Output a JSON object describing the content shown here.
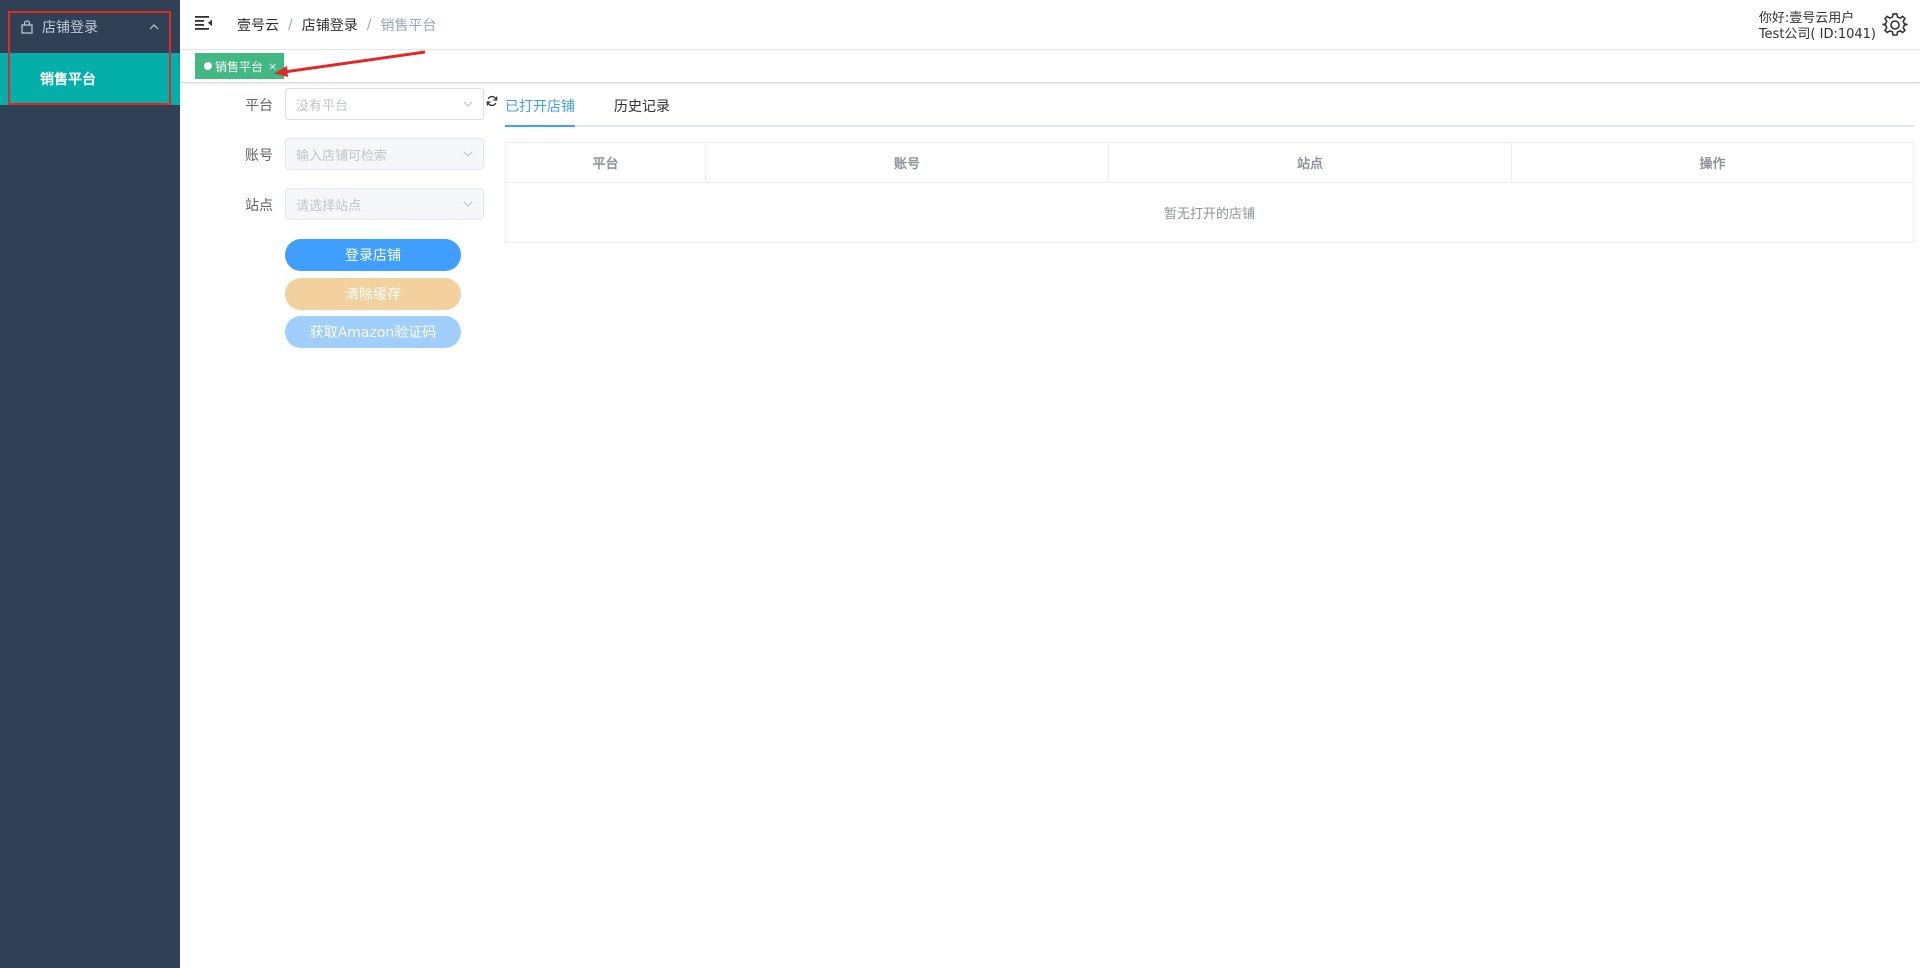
{
  "sidebar": {
    "group_label": "店铺登录",
    "items": [
      {
        "label": "销售平台",
        "active": true
      }
    ]
  },
  "navbar": {
    "breadcrumb": [
      "壹号云",
      "店铺登录",
      "销售平台"
    ],
    "user_greeting": "你好:壹号云用户",
    "user_company": "Test公司( ID:1041)"
  },
  "tags": [
    {
      "label": "销售平台",
      "close": "×"
    }
  ],
  "form": {
    "platform_label": "平台",
    "platform_placeholder": "没有平台",
    "account_label": "账号",
    "account_placeholder": "输入店铺可检索",
    "site_label": "站点",
    "site_placeholder": "请选择站点",
    "login_button": "登录店铺",
    "clear_cache_button": "清除缓存",
    "amazon_code_button": "获取Amazon验证码"
  },
  "tabs": [
    {
      "label": "已打开店铺",
      "active": true
    },
    {
      "label": "历史记录",
      "active": false
    }
  ],
  "table": {
    "columns": [
      "平台",
      "账号",
      "站点",
      "操作"
    ],
    "empty_text": "暂无打开的店铺"
  },
  "colors": {
    "sidebar_bg": "#304156",
    "active_menu_bg": "#05afa9",
    "tag_green": "#42b983",
    "primary": "#409eff",
    "annotation_red": "#e02a2a"
  },
  "icons": [
    "bag-icon",
    "chevron-up-icon",
    "hamburger-icon",
    "gear-icon",
    "chevron-down-icon",
    "refresh-icon"
  ]
}
